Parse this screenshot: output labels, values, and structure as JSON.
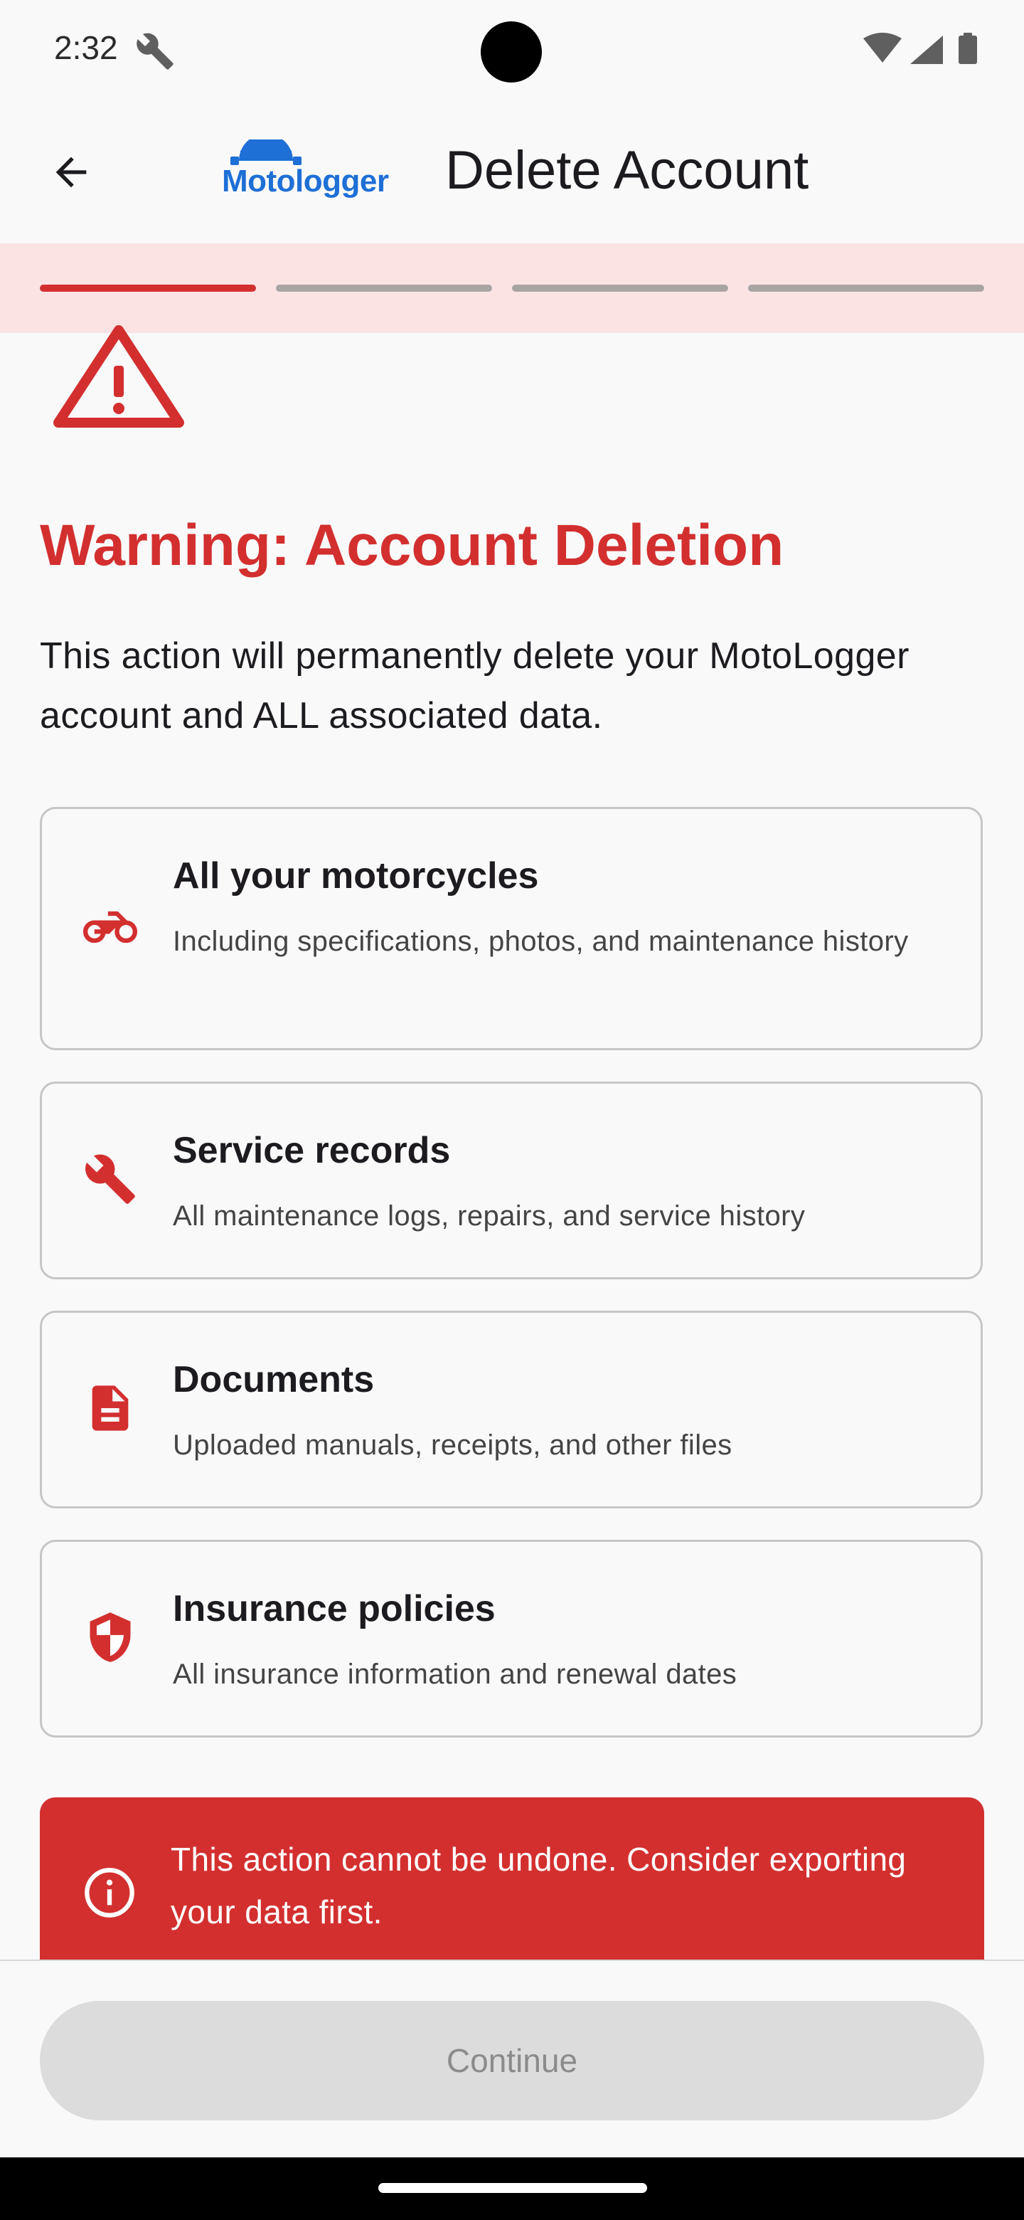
{
  "status_bar": {
    "time": "2:32",
    "icons": [
      "wrench-icon",
      "wifi-icon",
      "signal-icon",
      "battery-icon"
    ]
  },
  "app_bar": {
    "back_icon": "arrow-back-icon",
    "logo_text": "Motologger",
    "title": "Delete Account"
  },
  "progress": {
    "steps_total": 4,
    "current_step": 1,
    "active_color": "#d32f2f",
    "inactive_color": "#a9a4a4"
  },
  "warning": {
    "icon": "warning-triangle-icon",
    "title": "Warning: Account Deletion",
    "description": "This action will permanently delete your MotoLogger account and ALL associated data."
  },
  "items": [
    {
      "icon": "motorcycle-icon",
      "title": "All your motorcycles",
      "description": "Including specifications, photos, and maintenance history"
    },
    {
      "icon": "wrench-icon",
      "title": "Service records",
      "description": "All maintenance logs, repairs, and service history"
    },
    {
      "icon": "document-icon",
      "title": "Documents",
      "description": "Uploaded manuals, receipts, and other files"
    },
    {
      "icon": "shield-icon",
      "title": "Insurance policies",
      "description": "All insurance information and renewal dates"
    }
  ],
  "alert": {
    "icon": "info-icon",
    "text": "This action cannot be undone. Consider exporting your data first."
  },
  "footer": {
    "continue_label": "Continue"
  },
  "colors": {
    "accent": "#d32f2f",
    "brand": "#1e6fd6",
    "background": "#f9f9f9"
  }
}
